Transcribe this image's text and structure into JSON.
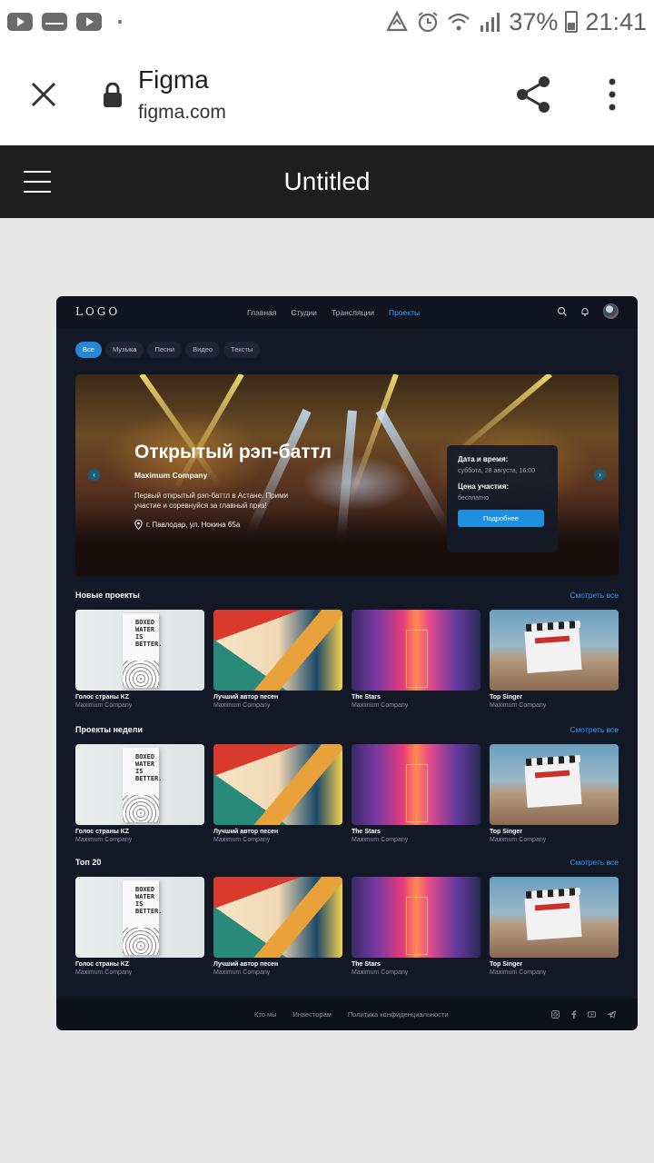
{
  "status_bar": {
    "battery": "37%",
    "time": "21:41",
    "notification_icons": [
      "youtube-icon",
      "mail-icon",
      "youtube-icon"
    ]
  },
  "browser": {
    "title": "Figma",
    "url": "figma.com"
  },
  "figma": {
    "file_title": "Untitled"
  },
  "site": {
    "logo": "LOGO",
    "nav": [
      "Главная",
      "Студии",
      "Трансляции",
      "Проекты"
    ],
    "active_nav": "Проекты",
    "filters": [
      "Все",
      "Музыка",
      "Песни",
      "Видео",
      "Тексты"
    ],
    "active_filter": "Все",
    "hero": {
      "title": "Открытый рэп-баттл",
      "company": "Maximum Company",
      "description": "Первый открытый рэп-баттл в Астане. Прими участие и соревнуйся за главный приз!",
      "location": "г. Павлодар, ул. Нокина 65а",
      "date_label": "Дата и время:",
      "date_value": "суббота, 28 августа, 16:00",
      "price_label": "Цена участия:",
      "price_value": "бесплатно",
      "button": "Подробнее"
    },
    "see_all": "Смотреть все",
    "sections": [
      {
        "title": "Новые проекты",
        "show_see_all": true,
        "cards": [
          {
            "title": "Голос страны KZ",
            "company": "Maximum Company"
          },
          {
            "title": "Лучший автор песен",
            "company": "Maximum Company"
          },
          {
            "title": "The Stars",
            "company": "Maximum Company"
          },
          {
            "title": "Top Singer",
            "company": "Maximum Company"
          }
        ]
      },
      {
        "title": "Проекты недели",
        "show_see_all": true,
        "cards": [
          {
            "title": "Голос страны KZ",
            "company": "Maximum Company"
          },
          {
            "title": "Лучший автор песен",
            "company": "Maximum Company"
          },
          {
            "title": "The Stars",
            "company": "Maximum Company"
          },
          {
            "title": "Top Singer",
            "company": "Maximum Company"
          }
        ]
      },
      {
        "title": "Топ 20",
        "show_see_all": true,
        "cards": [
          {
            "title": "Голос страны KZ",
            "company": "Maximum Company"
          },
          {
            "title": "Лучший автор песен",
            "company": "Maximum Company"
          },
          {
            "title": "The Stars",
            "company": "Maximum Company"
          },
          {
            "title": "Top Singer",
            "company": "Maximum Company"
          }
        ]
      }
    ],
    "footer_links": [
      "Кто мы",
      "Инвесторам",
      "Политика конфиденциальности"
    ],
    "social_icons": [
      "instagram-icon",
      "facebook-icon",
      "youtube-icon",
      "telegram-icon"
    ],
    "colors": {
      "accent": "#2488d6",
      "background": "#121826",
      "link": "#2ea0ff"
    }
  }
}
